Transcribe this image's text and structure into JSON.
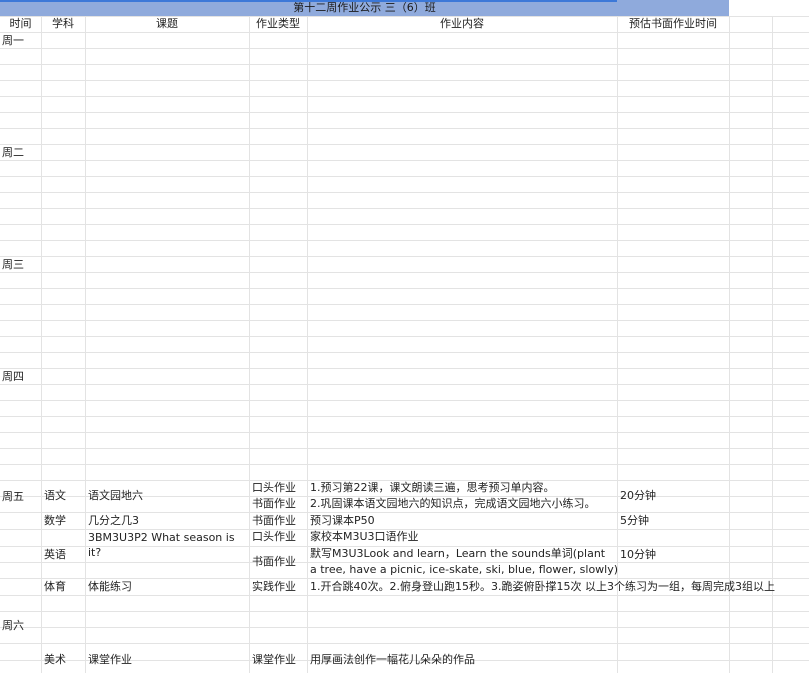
{
  "sheet": {
    "title": "第十二周作业公示 三（6）班",
    "headers": {
      "time": "时间",
      "subject": "学科",
      "topic": "课题",
      "type": "作业类型",
      "content": "作业内容",
      "duration": "预估书面作业时间"
    },
    "days": {
      "mon": "周一",
      "tue": "周二",
      "wed": "周三",
      "thu": "周四",
      "fri": "周五",
      "sat": "周六"
    },
    "friday": {
      "chinese": {
        "subject": "语文",
        "topic": "语文园地六",
        "type1": "口头作业",
        "content1": "1.预习第22课，课文朗读三遍，思考预习单内容。",
        "type2": "书面作业",
        "content2": "2.巩固课本语文园地六的知识点，完成语文园地六小练习。",
        "duration": "20分钟"
      },
      "math": {
        "subject": "数学",
        "topic": "几分之几3",
        "type": "书面作业",
        "content": "预习课本P50",
        "duration": "5分钟"
      },
      "english": {
        "subject": "英语",
        "topic_line1": "3BM3U3P2 What season is",
        "topic_line2": "it?",
        "type1": "口头作业",
        "content1": "家校本M3U3口语作业",
        "type2": "书面作业",
        "content2_line1": "默写M3U3Look and learn，Learn the sounds单词(plant",
        "content2_line2": "a tree, have a picnic, ice-skate, ski, blue, flower, slowly)",
        "duration": "10分钟"
      },
      "pe": {
        "subject": "体育",
        "topic": "体能练习",
        "type": "实践作业",
        "content": "1.开合跳40次。2.俯身登山跑15秒。3.跪姿俯卧撑15次 以上3个练习为一组，每周完成3组以上"
      }
    },
    "saturday": {
      "art": {
        "subject": "美术",
        "topic": "课堂作业",
        "type": "课堂作业",
        "content": "用厚画法创作一幅花儿朵朵的作品"
      }
    }
  }
}
